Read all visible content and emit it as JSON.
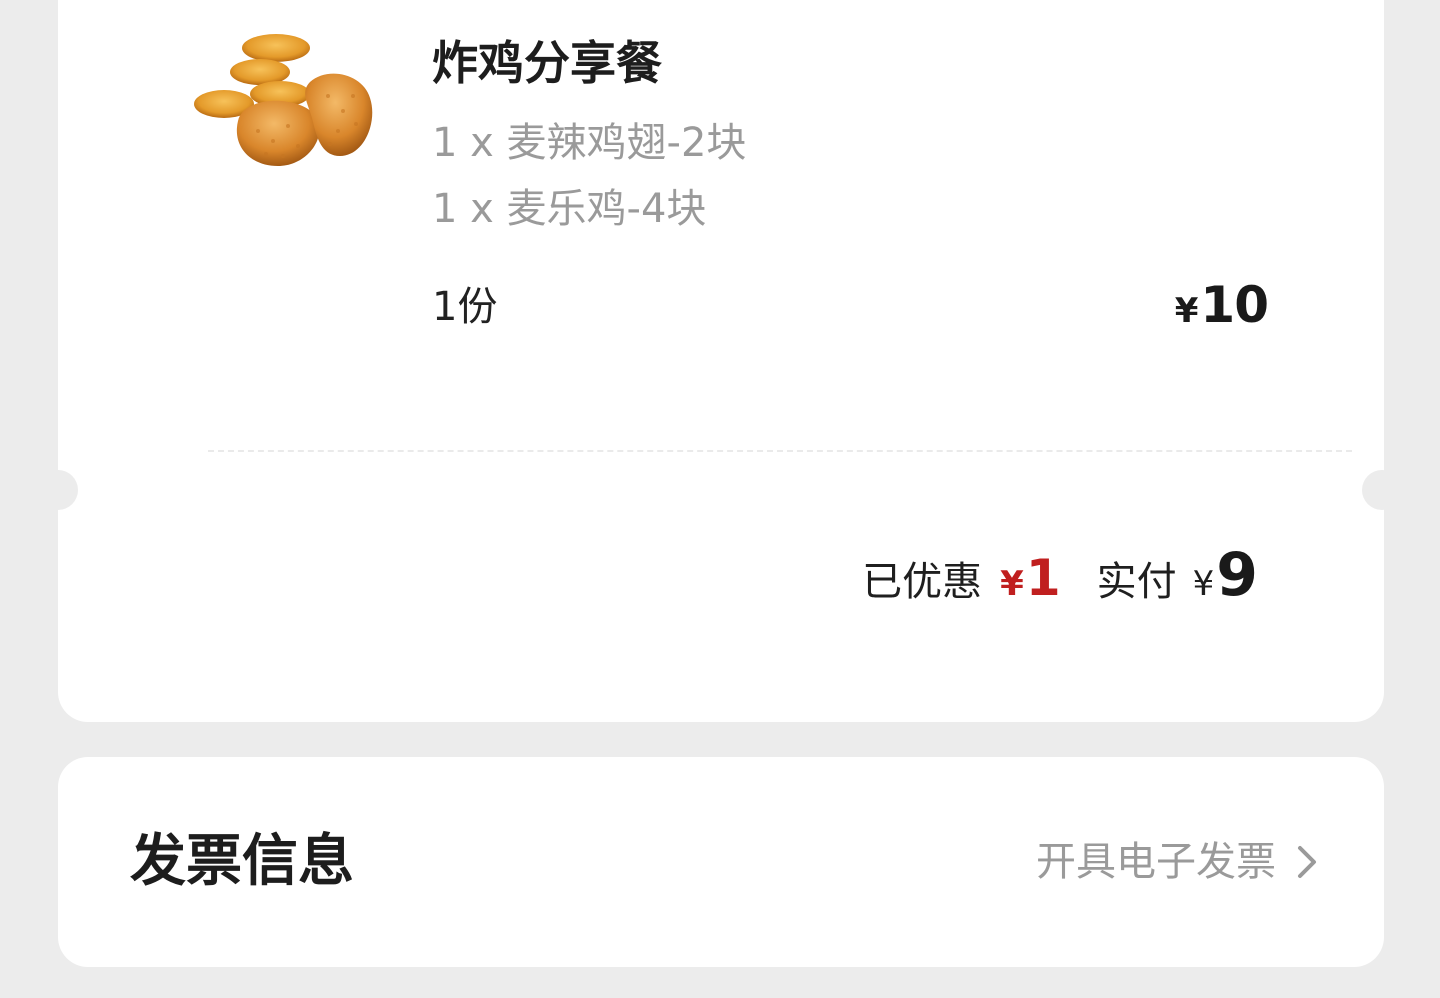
{
  "order": {
    "product_title": "炸鸡分享餐",
    "image_icon": "fried-chicken-image",
    "items": [
      "1 x 麦辣鸡翅-2块",
      "1 x 麦乐鸡-4块"
    ],
    "quantity": "1份",
    "price_symbol": "¥",
    "price_amount": "10",
    "discount_label": "已优惠",
    "discount_symbol": "¥",
    "discount_amount": "1",
    "paid_label": "实付",
    "paid_symbol": "¥",
    "paid_amount": "9"
  },
  "invoice": {
    "title": "发票信息",
    "action_label": "开具电子发票",
    "action_icon": "chevron-right-icon"
  },
  "colors": {
    "background": "#ececec",
    "card": "#ffffff",
    "discount_red": "#c01f1f",
    "muted_text": "#9a9a9a"
  }
}
